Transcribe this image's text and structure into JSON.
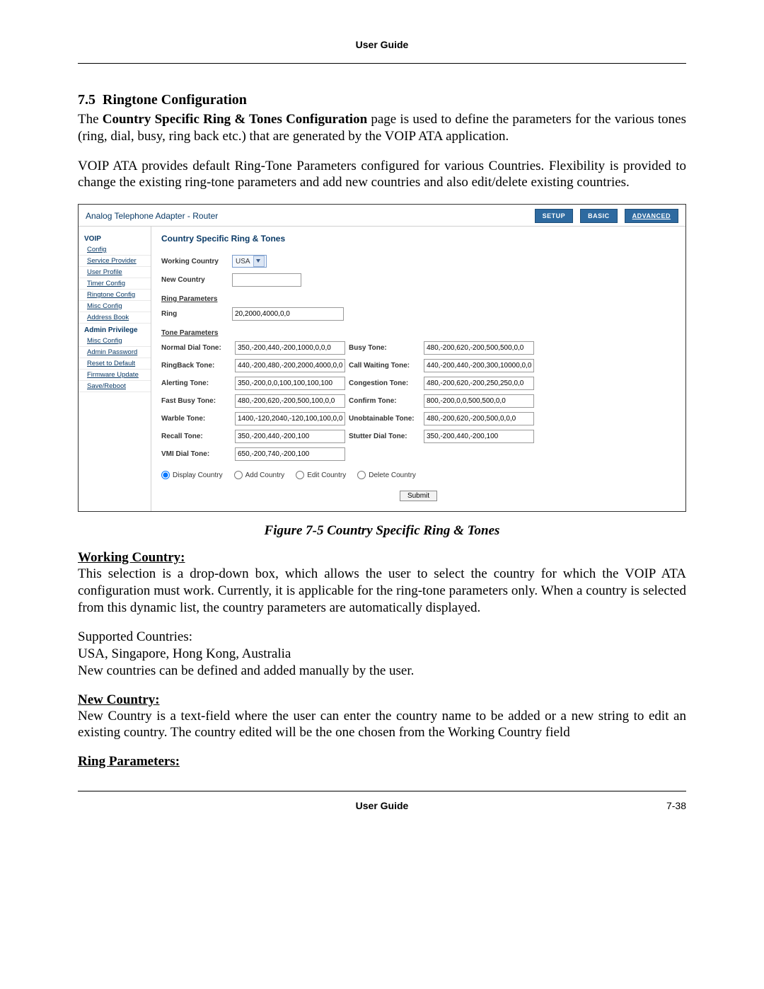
{
  "header": "User Guide",
  "section": {
    "number": "7.5",
    "title": "Ringtone Configuration"
  },
  "para1_lead": "The ",
  "para1_strong": "Country Specific Ring & Tones Configuration",
  "para1_tail": " page is used to define the parameters for the various tones (ring, dial, busy, ring back etc.) that are generated by the VOIP ATA application.",
  "para2": "VOIP ATA provides default Ring-Tone Parameters configured for various Countries. Flexibility is provided to change the existing ring-tone parameters and add new countries and also edit/delete existing countries.",
  "caption": "Figure 7-5 Country Specific Ring & Tones",
  "wc_head": "Working Country:",
  "wc_body": "This selection is a drop-down box, which allows the user to select the country for which the VOIP ATA configuration must work. Currently, it is applicable for the ring-tone parameters only. When a country is selected from this dynamic list, the country parameters are automatically displayed.",
  "supported_label": "Supported Countries:",
  "supported_list": "USA, Singapore, Hong Kong, Australia",
  "supported_note": "New countries can be defined and added manually by the user.",
  "nc_head": "New Country:",
  "nc_body": "New Country is a text-field where the user can enter the country name to be added or a new string to edit an existing country. The country edited will be the one chosen from the Working Country field",
  "rp_head": "Ring Parameters:",
  "footer_left": "",
  "footer_center": "User Guide",
  "footer_right": "7-38",
  "shot": {
    "title": "Analog Telephone Adapter - Router",
    "tabs": {
      "setup": "SETUP",
      "basic": "BASIC",
      "advanced": "ADVANCED"
    },
    "sidebar": {
      "voip": "VOIP",
      "items1": [
        "Config",
        "Service Provider",
        "User Profile",
        "Timer Config",
        "Ringtone Config",
        "Misc Config",
        "Address Book"
      ],
      "admin": "Admin Privilege",
      "items2": [
        "Misc Config",
        "Admin Password",
        "Reset to Default",
        "Firmware Update",
        "Save/Reboot"
      ]
    },
    "heading": "Country Specific Ring & Tones",
    "working_country_label": "Working Country",
    "working_country_value": "USA",
    "new_country_label": "New Country",
    "new_country_value": "",
    "ring_params_label": "Ring Parameters",
    "ring_label": "Ring",
    "ring_value": "20,2000,4000,0,0",
    "tone_params_label": "Tone Parameters",
    "tones": {
      "normal_dial": {
        "label": "Normal Dial Tone:",
        "value": "350,-200,440,-200,1000,0,0,0"
      },
      "busy": {
        "label": "Busy Tone:",
        "value": "480,-200,620,-200,500,500,0,0"
      },
      "ringback": {
        "label": "RingBack Tone:",
        "value": "440,-200,480,-200,2000,4000,0,0"
      },
      "call_wait": {
        "label": "Call Waiting Tone:",
        "value": "440,-200,440,-200,300,10000,0,0"
      },
      "alerting": {
        "label": "Alerting Tone:",
        "value": "350,-200,0,0,100,100,100,100"
      },
      "congestion": {
        "label": "Congestion Tone:",
        "value": "480,-200,620,-200,250,250,0,0"
      },
      "fast_busy": {
        "label": "Fast Busy Tone:",
        "value": "480,-200,620,-200,500,100,0,0"
      },
      "confirm": {
        "label": "Confirm Tone:",
        "value": "800,-200,0,0,500,500,0,0"
      },
      "warble": {
        "label": "Warble Tone:",
        "value": "1400,-120,2040,-120,100,100,0,0"
      },
      "unobtain": {
        "label": "Unobtainable Tone:",
        "value": "480,-200,620,-200,500,0,0,0"
      },
      "recall": {
        "label": "Recall Tone:",
        "value": "350,-200,440,-200,100"
      },
      "stutter": {
        "label": "Stutter Dial Tone:",
        "value": "350,-200,440,-200,100"
      },
      "vmi": {
        "label": "VMI Dial Tone:",
        "value": "650,-200,740,-200,100"
      }
    },
    "radios": {
      "display": "Display Country",
      "add": "Add Country",
      "edit": "Edit Country",
      "delete": "Delete Country"
    },
    "submit": "Submit"
  }
}
